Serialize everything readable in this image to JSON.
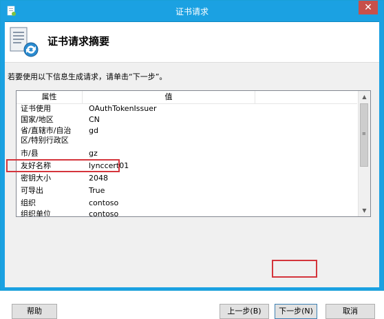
{
  "window": {
    "title": "证书请求",
    "close_glyph": "✕",
    "title_color": "#1ba1e2"
  },
  "header": {
    "title": "证书请求摘要",
    "icon": "certificate-request-icon"
  },
  "instruction": "若要使用以下信息生成请求，请单击“下一步”。",
  "list": {
    "columns": {
      "property": "属性",
      "value": "值"
    },
    "rows": [
      {
        "property": "证书使用",
        "value": "OAuthTokenIssuer"
      },
      {
        "property": "国家/地区",
        "value": "CN"
      },
      {
        "property": "省/直辖市/自治区/特别行政区",
        "value": "gd"
      },
      {
        "property": "市/县",
        "value": "gz"
      },
      {
        "property": "友好名称",
        "value": "lynccert01"
      },
      {
        "property": "密钥大小",
        "value": "2048"
      },
      {
        "property": "可导出",
        "value": "True"
      },
      {
        "property": "组织",
        "value": "contoso"
      },
      {
        "property": "组织单位",
        "value": "contoso"
      }
    ],
    "highlighted_row": "友好名称"
  },
  "buttons": {
    "help": "帮助",
    "back": "上一步(B)",
    "next": "下一步(N)",
    "cancel": "取消"
  },
  "colors": {
    "highlight_border": "#d4343b",
    "close_button": "#c7504a"
  }
}
